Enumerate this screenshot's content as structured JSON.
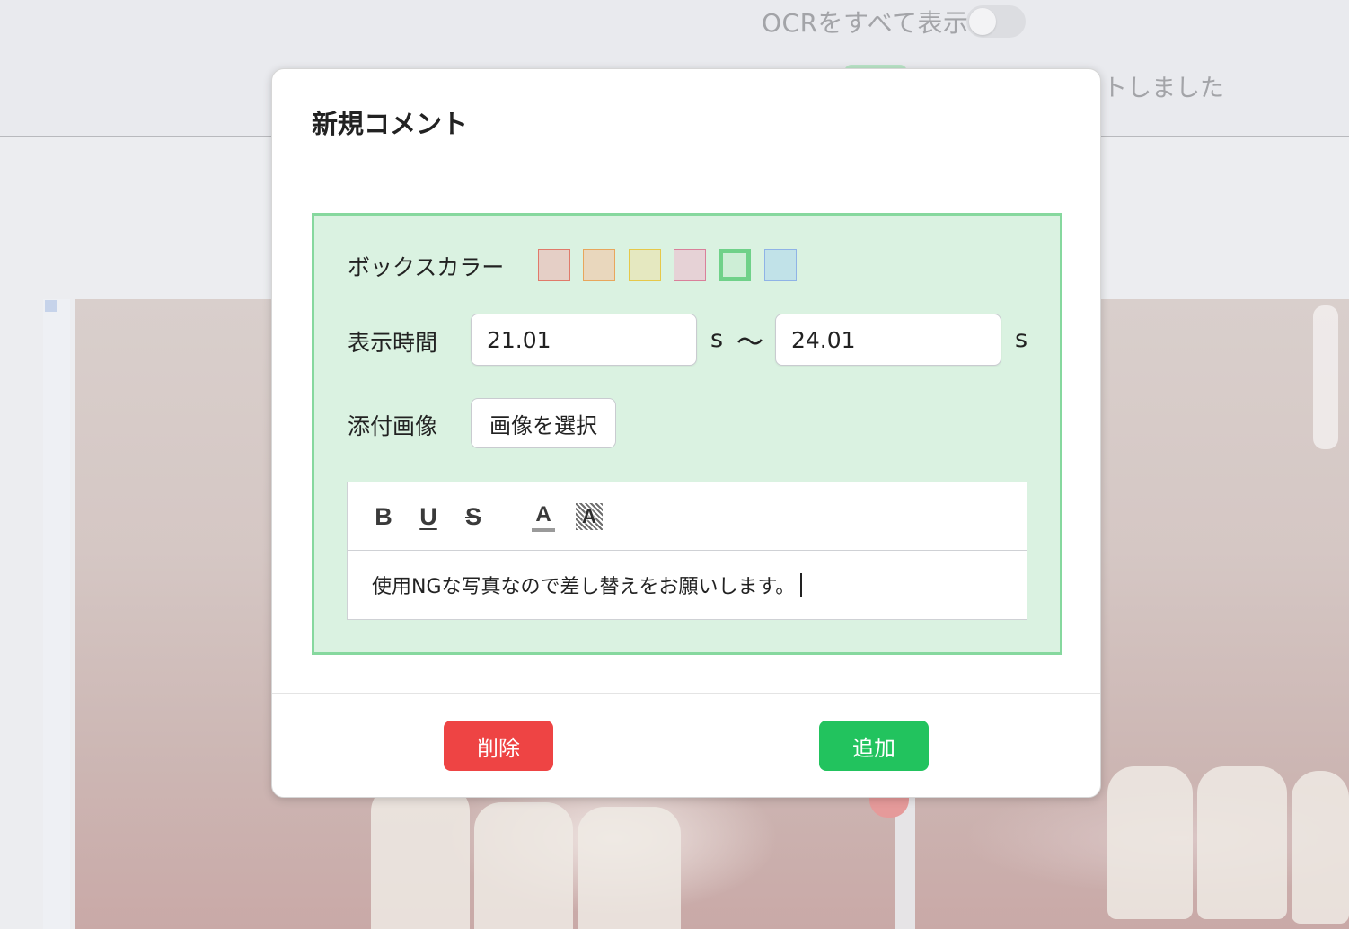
{
  "background": {
    "ocr_toggle_label": "OCRをすべて表示",
    "status_text": "トしました"
  },
  "modal": {
    "title": "新規コメント",
    "box_color": {
      "label": "ボックスカラー",
      "swatches": [
        {
          "name": "red",
          "fill": "#e5cfc6",
          "border": "#e07a6a",
          "selected": false
        },
        {
          "name": "orange",
          "fill": "#e9d7bd",
          "border": "#e8a65c",
          "selected": false
        },
        {
          "name": "yellow",
          "fill": "#e5e8c0",
          "border": "#e6c84a",
          "selected": false
        },
        {
          "name": "pink",
          "fill": "#e6d2d6",
          "border": "#d9809a",
          "selected": false
        },
        {
          "name": "green",
          "fill": "#cdeed6",
          "border": "#6fd189",
          "selected": true
        },
        {
          "name": "blue",
          "fill": "#c1e2e8",
          "border": "#8fb3e6",
          "selected": false
        }
      ]
    },
    "display_time": {
      "label": "表示時間",
      "start": "21.01",
      "end": "24.01",
      "unit": "s",
      "separator": "〜"
    },
    "attachment": {
      "label": "添付画像",
      "button": "画像を選択"
    },
    "editor": {
      "toolbar": {
        "bold": "B",
        "underline": "U",
        "strike": "S",
        "text_color": "A",
        "bg_color": "A"
      },
      "content": "使用NGな写真なので差し替えをお願いします。"
    },
    "footer": {
      "delete_label": "削除",
      "add_label": "追加"
    }
  },
  "colors": {
    "panel_bg": "#daf2e1",
    "panel_border": "#86d89e",
    "delete": "#ee4444",
    "add": "#22c35e"
  }
}
